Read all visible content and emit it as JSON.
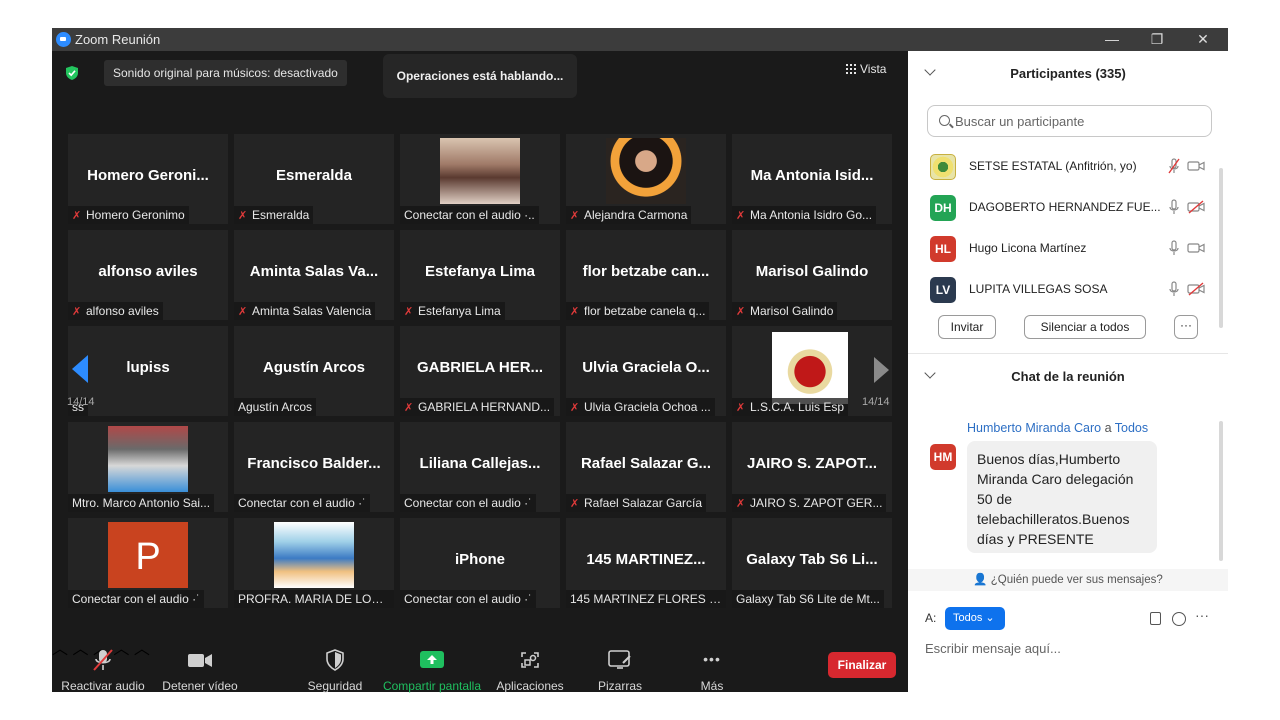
{
  "window": {
    "title": "Zoom Reunión",
    "minimize": "—",
    "restore": "❐",
    "close": "✕"
  },
  "video": {
    "sound_pill": "Sonido original para músicos: desactivado",
    "speaking": "Operaciones está hablando...",
    "view_label": "Vista",
    "page_left": "14/14",
    "page_right": "14/14"
  },
  "tiles": [
    {
      "big": "Homero  Geroni...",
      "label": "Homero Geronimo",
      "muted": true
    },
    {
      "big": "Esmeralda",
      "label": "Esmeralda",
      "muted": true
    },
    {
      "big": "",
      "label": "Conectar con el audio ·..",
      "muted": false,
      "pic": "photo-woman-1"
    },
    {
      "big": "",
      "label": "Alejandra Carmona",
      "muted": true,
      "pic": "photo-woman-2"
    },
    {
      "big": "Ma Antonia  Isid...",
      "label": "Ma Antonia Isidro Go...",
      "muted": true
    },
    {
      "big": "alfonso aviles",
      "label": "alfonso aviles",
      "muted": true
    },
    {
      "big": "Aminta  Salas  Va...",
      "label": "Aminta Salas Valencia",
      "muted": true
    },
    {
      "big": "Estefanya  Lima",
      "label": "Estefanya Lima",
      "muted": true
    },
    {
      "big": "flor  betzabe  can...",
      "label": "flor betzabe canela q...",
      "muted": true
    },
    {
      "big": "Marisol  Galindo",
      "label": "Marisol Galindo",
      "muted": true
    },
    {
      "big": "lupiss",
      "label": "ss",
      "muted": false
    },
    {
      "big": "Agustín  Arcos",
      "label": "Agustín Arcos",
      "muted": false
    },
    {
      "big": "GABRIELA  HER...",
      "label": "GABRIELA HERNAND...",
      "muted": true
    },
    {
      "big": "Ulvia  Graciela  O...",
      "label": "Ulvia Graciela Ochoa ...",
      "muted": true
    },
    {
      "big": "",
      "label": "L.S.C.A. Luis Esp",
      "muted": true,
      "pic": "crest-image"
    },
    {
      "big": "",
      "label": "Mtro. Marco Antonio Sai...",
      "muted": false,
      "pic": "group-photo"
    },
    {
      "big": "Francisco  Balder...",
      "label": "Conectar con el audio ·˙",
      "muted": false
    },
    {
      "big": "Liliana  Callejas...",
      "label": "Conectar con el audio ·˙",
      "muted": false
    },
    {
      "big": "Rafael  Salazar  G...",
      "label": "Rafael Salazar García",
      "muted": true
    },
    {
      "big": "JAIRO  S.  ZAPOT...",
      "label": "JAIRO S. ZAPOT GER...",
      "muted": true
    },
    {
      "big": "",
      "label": "Conectar con el audio ·˙",
      "muted": false,
      "pic": "powerpoint-icon"
    },
    {
      "big": "",
      "label": "PROFRA. MARIA DE LOS ...",
      "muted": false,
      "pic": "cartoon-family"
    },
    {
      "big": "iPhone",
      "label": "Conectar con el audio ·˙",
      "muted": false
    },
    {
      "big": "145  MARTINEZ...",
      "label": "145 MARTINEZ FLORES F...",
      "muted": false
    },
    {
      "big": "Galaxy  Tab  S6  Li...",
      "label": "Galaxy Tab S6 Lite de Mt...",
      "muted": false
    }
  ],
  "powerpoint_letter": "P",
  "toolbar": {
    "unmute": "Reactivar audio",
    "stop_video": "Detener vídeo",
    "security": "Seguridad",
    "share": "Compartir pantalla",
    "apps": "Aplicaciones",
    "whiteboards": "Pizarras",
    "more": "Más",
    "end": "Finalizar",
    "more_dots": "•••"
  },
  "participants": {
    "title": "Participantes (335)",
    "search_placeholder": "Buscar un participante",
    "list": [
      {
        "initials": "",
        "name": "SETSE ESTATAL (Anfitrión, yo)",
        "color": "#e8e4a8",
        "mic": "muted",
        "cam": "on"
      },
      {
        "initials": "DH",
        "name": "DAGOBERTO HERNANDEZ FUE...",
        "color": "#23a455",
        "mic": "on",
        "cam": "off"
      },
      {
        "initials": "HL",
        "name": "Hugo Licona Martínez",
        "color": "#d13a2c",
        "mic": "on",
        "cam": "on"
      },
      {
        "initials": "LV",
        "name": "LUPITA  VILLEGAS SOSA",
        "color": "#2b3a4f",
        "mic": "on",
        "cam": "off"
      }
    ],
    "invite": "Invitar",
    "mute_all": "Silenciar a todos",
    "more": "···"
  },
  "chat": {
    "title": "Chat de la reunión",
    "from": "Humberto Miranda Caro",
    "to_word": "a",
    "to": "Todos",
    "avatar": "HM",
    "message": "Buenos días,Humberto Miranda Caro delegación 50 de telebachilleratos.Buenos días y PRESENTE",
    "who_sees": "¿Quién puede ver sus mensajes?",
    "to_label": "A:",
    "recipient": "Todos ⌄",
    "input_placeholder": "Escribir mensaje aquí...",
    "more": "···"
  },
  "colors": {
    "accent": "#2d8cff",
    "end_red": "#d7282f",
    "share_green": "#1fbf5f",
    "muted_red": "#e03a3a"
  }
}
